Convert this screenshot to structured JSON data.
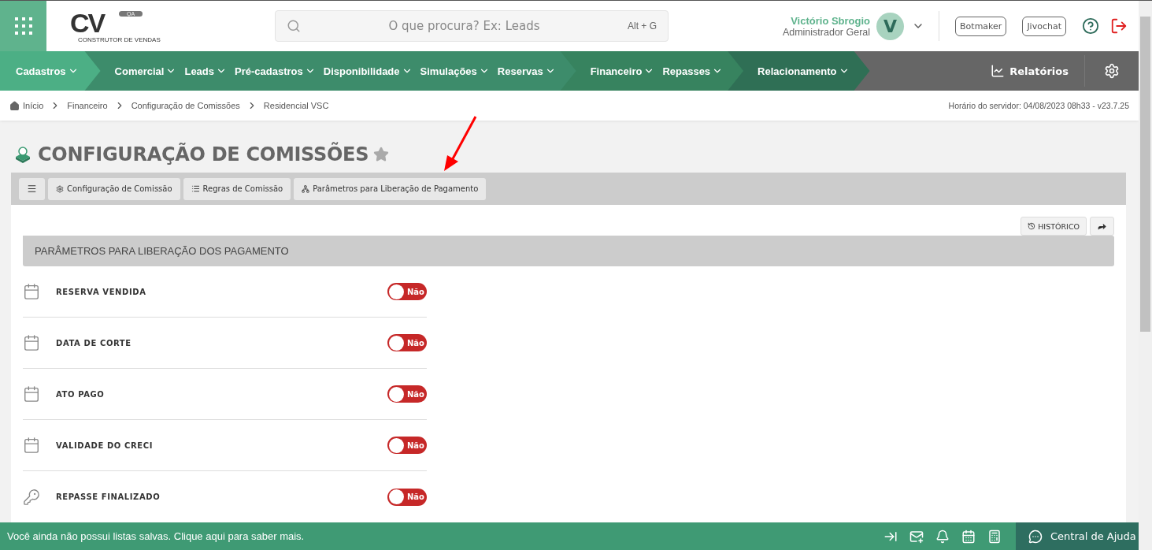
{
  "header": {
    "logo": {
      "text": "CV",
      "badge": "QA",
      "tagline": "CONSTRUTOR DE VENDAS"
    },
    "search": {
      "placeholder": "O que procura? Ex: Leads",
      "shortcut": "Alt + G"
    },
    "user": {
      "name": "Victório Sbrogio",
      "role": "Administrador Geral",
      "initial": "V"
    },
    "buttons": [
      "Botmaker",
      "Jivochat"
    ]
  },
  "nav": {
    "groups": [
      {
        "items": [
          "Cadastros"
        ]
      },
      {
        "items": [
          "Comercial",
          "Leads",
          "Pré-cadastros",
          "Disponibilidade",
          "Simulações",
          "Reservas"
        ]
      },
      {
        "items": [
          "Financeiro",
          "Repasses"
        ]
      },
      {
        "items": [
          "Relacionamento"
        ]
      }
    ],
    "reports": "Relatórios"
  },
  "breadcrumb": {
    "items": [
      "Início",
      "Financeiro",
      "Configuração de Comissões",
      "Residencial VSC"
    ],
    "server_time": "Horário do servidor: 04/08/2023 08h33 - v23.7.25"
  },
  "page": {
    "title": "CONFIGURAÇÃO DE COMISSÕES",
    "favorite": false
  },
  "toolbar": {
    "tabs": [
      {
        "label": "Configuração de Comissão",
        "kind": "gear"
      },
      {
        "label": "Regras de Comissão",
        "kind": "list"
      },
      {
        "label": "Parâmetros para Liberação de Pagamento",
        "kind": "tree"
      }
    ]
  },
  "actions": {
    "history": "HISTÓRICO"
  },
  "section": {
    "title": "PARÂMETROS PARA LIBERAÇÃO DOS PAGAMENTO",
    "rows": [
      {
        "label": "RESERVA VENDIDA",
        "kind": "calendar",
        "on": false,
        "state": "Não"
      },
      {
        "label": "DATA DE CORTE",
        "kind": "calendar",
        "on": false,
        "state": "Não"
      },
      {
        "label": "ATO PAGO",
        "kind": "calendar",
        "on": false,
        "state": "Não"
      },
      {
        "label": "VALIDADE DO CRECI",
        "kind": "calendar",
        "on": false,
        "state": "Não"
      },
      {
        "label": "REPASSE FINALIZADO",
        "kind": "key",
        "on": false,
        "state": "Não"
      }
    ]
  },
  "footer": {
    "message": "Você ainda não possui listas salvas. Clique aqui para saber mais.",
    "help": "Central de Ajuda"
  }
}
